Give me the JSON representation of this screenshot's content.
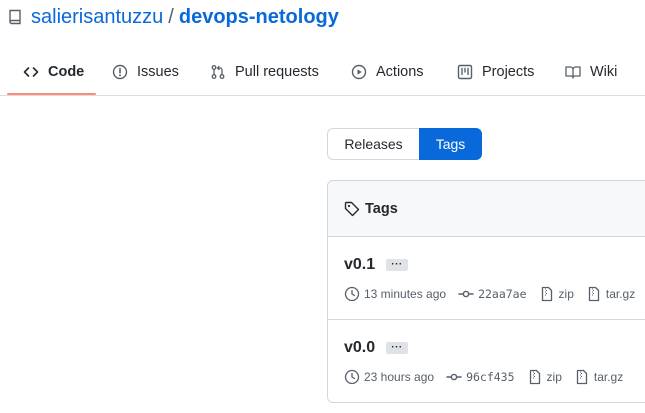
{
  "repo": {
    "owner": "salierisantuzzu",
    "separator": "/",
    "name": "devops-netology"
  },
  "nav": {
    "tabs": [
      {
        "label": "Code",
        "icon": "code-icon",
        "selected": true
      },
      {
        "label": "Issues",
        "icon": "issue-icon"
      },
      {
        "label": "Pull requests",
        "icon": "pull-request-icon"
      },
      {
        "label": "Actions",
        "icon": "play-icon"
      },
      {
        "label": "Projects",
        "icon": "project-icon"
      },
      {
        "label": "Wiki",
        "icon": "book-icon"
      }
    ]
  },
  "switcher": {
    "releases": "Releases",
    "tags": "Tags",
    "selected": "Tags"
  },
  "tags_box": {
    "title": "Tags",
    "items": [
      {
        "name": "v0.1",
        "more": "···",
        "time": "13 minutes ago",
        "sha": "22aa7ae",
        "zip": "zip",
        "targz": "tar.gz"
      },
      {
        "name": "v0.0",
        "more": "···",
        "time": "23 hours ago",
        "sha": "96cf435",
        "zip": "zip",
        "targz": "tar.gz"
      }
    ]
  },
  "colors": {
    "link": "#0969da",
    "selected_underline": "#fd8c73",
    "border": "#d0d7de",
    "muted": "#57606a"
  }
}
